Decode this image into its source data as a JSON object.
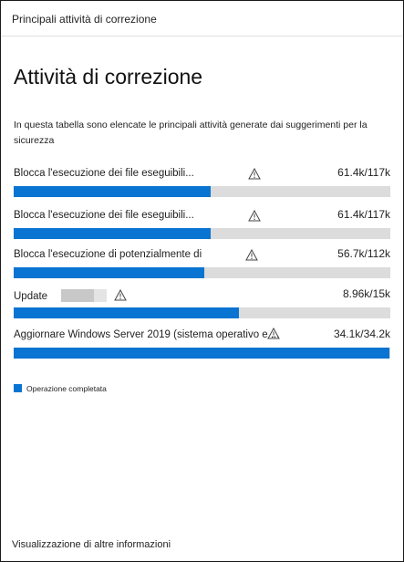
{
  "header": {
    "title": "Principali attività di correzione"
  },
  "main": {
    "title": "Attività di correzione",
    "description": "In questa tabella sono elencate le principali attività generate dai suggerimenti per la sicurezza"
  },
  "activities": [
    {
      "label": "Blocca l'esecuzione dei file eseguibili...",
      "count": "61.4k/117k",
      "progress": 0.524,
      "icon": "warning-icon"
    },
    {
      "label": "Blocca l'esecuzione dei file eseguibili...",
      "count": "61.4k/117k",
      "progress": 0.524,
      "icon": "warning-icon"
    },
    {
      "label": "Blocca l'esecuzione di potenzialmente di",
      "count": "56.7k/112k",
      "progress": 0.506,
      "icon": "warning-icon"
    },
    {
      "label": "Update",
      "count": "8.96k/15k",
      "progress": 0.597,
      "icon": "warning-icon"
    },
    {
      "label": "Aggiornare Windows Server 2019 (sistema operativo e ...",
      "count": "34.1k/34.2k",
      "progress": 0.997,
      "icon": "warning-icon"
    }
  ],
  "legend": {
    "label": "Operazione completata",
    "color": "#0a74d2"
  },
  "footer": {
    "more_link": "Visualizzazione di altre informazioni"
  }
}
